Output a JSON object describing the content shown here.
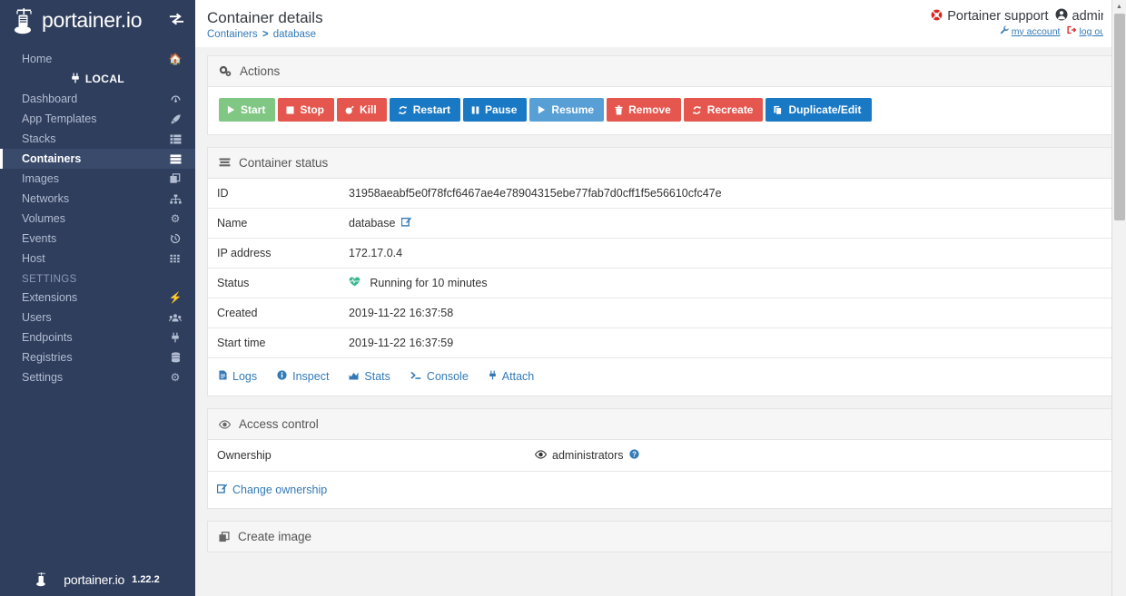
{
  "brand": {
    "name": "portainer.io",
    "toggle_icon": "sidebar-toggle-icon",
    "footer_name": "portainer.io",
    "version": "1.22.2"
  },
  "sidebar": {
    "home": {
      "label": "Home",
      "icon": "home-icon"
    },
    "endpoint": {
      "label": "LOCAL",
      "icon": "plug-icon"
    },
    "items": [
      {
        "label": "Dashboard",
        "icon": "dashboard-icon",
        "active": false
      },
      {
        "label": "App Templates",
        "icon": "rocket-icon",
        "active": false
      },
      {
        "label": "Stacks",
        "icon": "stacks-icon",
        "active": false
      },
      {
        "label": "Containers",
        "icon": "containers-icon",
        "active": true
      },
      {
        "label": "Images",
        "icon": "images-icon",
        "active": false
      },
      {
        "label": "Networks",
        "icon": "networks-icon",
        "active": false
      },
      {
        "label": "Volumes",
        "icon": "volumes-icon",
        "active": false
      },
      {
        "label": "Events",
        "icon": "events-history-icon",
        "active": false
      },
      {
        "label": "Host",
        "icon": "host-grid-icon",
        "active": false
      }
    ],
    "settings_section": "SETTINGS",
    "settings_items": [
      {
        "label": "Extensions",
        "icon": "bolt-icon"
      },
      {
        "label": "Users",
        "icon": "users-icon"
      },
      {
        "label": "Endpoints",
        "icon": "plug-icon"
      },
      {
        "label": "Registries",
        "icon": "database-icon"
      },
      {
        "label": "Settings",
        "icon": "gears-icon"
      }
    ]
  },
  "header": {
    "title": "Container details",
    "breadcrumb": {
      "root": "Containers",
      "separator": ">",
      "current": "database"
    },
    "support_label": "Portainer support",
    "support_icon": "lifebuoy-icon",
    "user_name": "admin",
    "user_icon": "user-circle-icon",
    "my_account_label": "my account",
    "my_account_icon": "wrench-icon",
    "logout_label": "log out",
    "logout_icon": "sign-out-icon"
  },
  "actions": {
    "panel_title": "Actions",
    "panel_icon": "gears-icon",
    "buttons": [
      {
        "label": "Start",
        "icon": "play-icon",
        "style": "btn-start"
      },
      {
        "label": "Stop",
        "icon": "stop-icon",
        "style": "btn-danger"
      },
      {
        "label": "Kill",
        "icon": "bomb-icon",
        "style": "btn-danger"
      },
      {
        "label": "Restart",
        "icon": "refresh-icon",
        "style": "btn-blue"
      },
      {
        "label": "Pause",
        "icon": "pause-icon",
        "style": "btn-blue"
      },
      {
        "label": "Resume",
        "icon": "play-icon",
        "style": "btn-lightblue"
      },
      {
        "label": "Remove",
        "icon": "trash-icon",
        "style": "btn-danger"
      },
      {
        "label": "Recreate",
        "icon": "refresh-icon",
        "style": "btn-danger"
      },
      {
        "label": "Duplicate/Edit",
        "icon": "copy-icon",
        "style": "btn-blue"
      }
    ]
  },
  "container_status": {
    "panel_title": "Container status",
    "panel_icon": "list-icon",
    "rows": [
      {
        "key": "ID",
        "value": "31958aeabf5e0f78fcf6467ae4e78904315ebe77fab7d0cff1f5e56610cfc47e"
      },
      {
        "key": "Name",
        "value": "database"
      },
      {
        "key": "IP address",
        "value": "172.17.0.4"
      },
      {
        "key": "Status",
        "value": "Running for 10 minutes"
      },
      {
        "key": "Created",
        "value": "2019-11-22 16:37:58"
      },
      {
        "key": "Start time",
        "value": "2019-11-22 16:37:59"
      }
    ],
    "name_edit_icon": "edit-pencil-icon",
    "status_icon": "heartbeat-icon",
    "links": [
      {
        "label": "Logs",
        "icon": "file-text-icon"
      },
      {
        "label": "Inspect",
        "icon": "info-circle-icon"
      },
      {
        "label": "Stats",
        "icon": "chart-area-icon"
      },
      {
        "label": "Console",
        "icon": "terminal-icon"
      },
      {
        "label": "Attach",
        "icon": "plug-icon"
      }
    ]
  },
  "access_control": {
    "panel_title": "Access control",
    "panel_icon": "eye-icon",
    "ownership_label": "Ownership",
    "ownership_value": "administrators",
    "ownership_icon": "eye-icon",
    "help_icon": "question-circle-icon",
    "change_label": "Change ownership",
    "change_icon": "edit-pencil-icon"
  },
  "create_image": {
    "panel_title": "Create image",
    "panel_icon": "clone-icon"
  },
  "colors": {
    "sidebar_bg": "#2f3e5d",
    "sidebar_active_bg": "#3a4a6b",
    "link": "#337ab7",
    "green": "#81c784",
    "red": "#e4564e",
    "blue": "#1a79c4",
    "light_blue": "#589fd6",
    "heartbeat_green": "#3bb78f",
    "support_red": "#d9241f"
  }
}
